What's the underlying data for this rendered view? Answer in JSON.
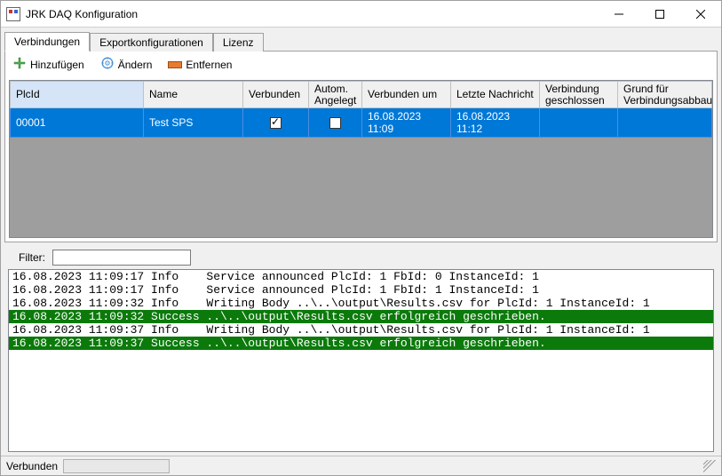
{
  "window": {
    "title": "JRK DAQ Konfiguration"
  },
  "tabs": [
    {
      "label": "Verbindungen",
      "active": true
    },
    {
      "label": "Exportkonfigurationen",
      "active": false
    },
    {
      "label": "Lizenz",
      "active": false
    }
  ],
  "toolbar": {
    "add_label": "Hinzufügen",
    "edit_label": "Ändern",
    "remove_label": "Entfernen"
  },
  "grid": {
    "columns": [
      {
        "label": "PlcId",
        "sorted": true
      },
      {
        "label": "Name"
      },
      {
        "label": "Verbunden"
      },
      {
        "label": "Autom. Angelegt"
      },
      {
        "label": "Verbunden um"
      },
      {
        "label": "Letzte Nachricht"
      },
      {
        "label": "Verbindung geschlossen"
      },
      {
        "label": "Grund für Verbindungsabbau"
      }
    ],
    "rows": [
      {
        "plcid": "00001",
        "name": "Test SPS",
        "verbunden": true,
        "autom_angelegt": false,
        "verbunden_um": "16.08.2023 11:09",
        "letzte_nachricht": "16.08.2023 11:12",
        "verbindung_geschlossen": "",
        "grund": ""
      }
    ]
  },
  "filter": {
    "label": "Filter:",
    "value": ""
  },
  "log": [
    {
      "ts": "16.08.2023 11:09:17",
      "level": "Info",
      "msg": "Service announced PlcId: 1 FbId: 0 InstanceId: 1"
    },
    {
      "ts": "16.08.2023 11:09:17",
      "level": "Info",
      "msg": "Service announced PlcId: 1 FbId: 1 InstanceId: 1"
    },
    {
      "ts": "16.08.2023 11:09:32",
      "level": "Info",
      "msg": "Writing Body ..\\..\\output\\Results.csv for PlcId: 1 InstanceId: 1"
    },
    {
      "ts": "16.08.2023 11:09:32",
      "level": "Success",
      "msg": "..\\..\\output\\Results.csv erfolgreich geschrieben."
    },
    {
      "ts": "16.08.2023 11:09:37",
      "level": "Info",
      "msg": "Writing Body ..\\..\\output\\Results.csv for PlcId: 1 InstanceId: 1"
    },
    {
      "ts": "16.08.2023 11:09:37",
      "level": "Success",
      "msg": "..\\..\\output\\Results.csv erfolgreich geschrieben."
    }
  ],
  "statusbar": {
    "text": "Verbunden"
  }
}
